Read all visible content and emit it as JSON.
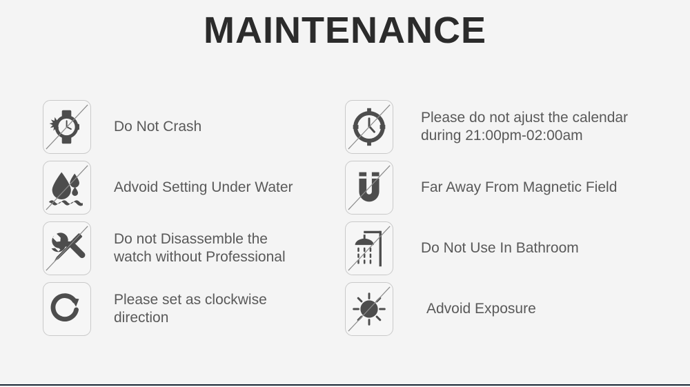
{
  "page": {
    "title": "MAINTENANCE",
    "background_color": "#f4f4f4",
    "title_color": "#2b2b2b",
    "label_color": "#595959",
    "icon_color": "#4d4d4d",
    "icon_box_border_color": "#c9c9c9",
    "bottom_rule_color": "#1b2836"
  },
  "columns": {
    "left": {
      "items": [
        {
          "icon": "watch-crash-icon",
          "label": "Do Not Crash",
          "prohibited": true
        },
        {
          "icon": "water-drop-icon",
          "label": "Advoid Setting Under Water",
          "prohibited": true
        },
        {
          "icon": "wrench-screwdriver-icon",
          "label": "Do not Disassemble the\nwatch without Professional",
          "prohibited": true
        },
        {
          "icon": "clockwise-arrow-icon",
          "label": "Please set as clockwise\ndirection",
          "prohibited": false
        }
      ]
    },
    "right": {
      "items": [
        {
          "icon": "clock-icon",
          "label": "Please do not ajust the calendar\nduring 21:00pm-02:00am",
          "prohibited": true
        },
        {
          "icon": "magnet-icon",
          "label": "Far Away From Magnetic Field",
          "prohibited": true
        },
        {
          "icon": "shower-icon",
          "label": "Do Not Use In Bathroom",
          "prohibited": true
        },
        {
          "icon": "sun-icon",
          "label": "Advoid Exposure",
          "prohibited": true
        }
      ]
    }
  }
}
